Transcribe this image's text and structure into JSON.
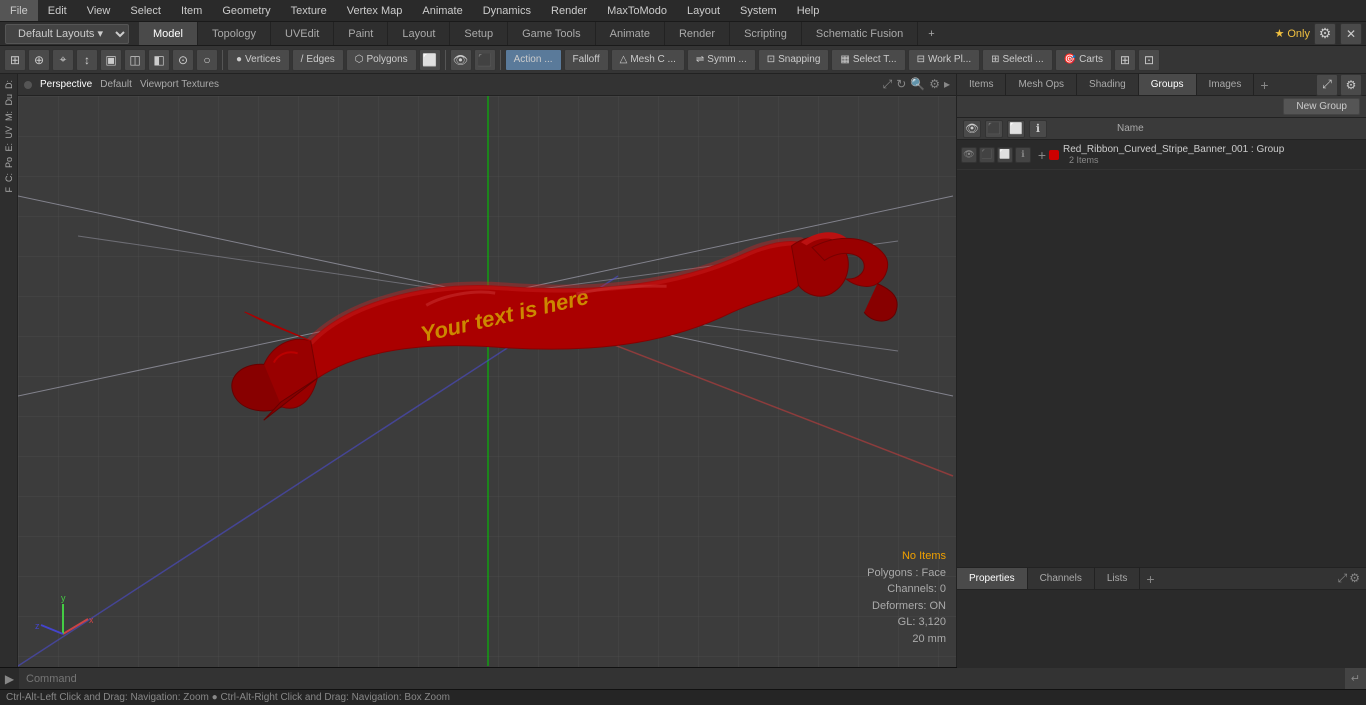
{
  "menubar": {
    "items": [
      "File",
      "Edit",
      "View",
      "Select",
      "Item",
      "Geometry",
      "Texture",
      "Vertex Map",
      "Animate",
      "Dynamics",
      "Render",
      "MaxToModo",
      "Layout",
      "System",
      "Help"
    ]
  },
  "layouts_bar": {
    "dropdown": "Default Layouts",
    "tabs": [
      "Model",
      "Topology",
      "UVEdit",
      "Paint",
      "Layout",
      "Setup",
      "Game Tools",
      "Animate",
      "Render",
      "Scripting",
      "Schematic Fusion"
    ],
    "active_tab": "Model",
    "plus": "+",
    "star_only": "★ Only"
  },
  "toolbar": {
    "mode_buttons": [
      "Vertices",
      "Edges",
      "Polygons"
    ],
    "action_label": "Action ...",
    "falloff_label": "Falloff",
    "mesh_c_label": "Mesh C ...",
    "symm_label": "Symm ...",
    "snapping_label": "Snapping",
    "select_t_label": "Select T...",
    "work_pl_label": "Work Pl...",
    "selecti_label": "Selecti ...",
    "carts_label": "Carts"
  },
  "viewport": {
    "dot_color": "#888",
    "perspective_label": "Perspective",
    "default_label": "Default",
    "viewport_textures_label": "Viewport Textures",
    "status": {
      "no_items": "No Items",
      "polygons": "Polygons : Face",
      "channels": "Channels: 0",
      "deformers": "Deformers: ON",
      "gl": "GL: 3,120",
      "size": "20 mm"
    }
  },
  "left_sidebar": {
    "letters": [
      "D",
      "Du",
      "M:",
      "UV",
      "E:",
      "Po",
      "C:",
      "F"
    ]
  },
  "right_panel": {
    "top_tabs": [
      "Items",
      "Mesh Ops",
      "Shading",
      "Groups",
      "Images"
    ],
    "active_top_tab": "Groups",
    "new_group_label": "New Group",
    "col_headers": [
      "Name"
    ],
    "groups": [
      {
        "name": "Red_Ribbon_Curved_Stripe_Banner_001 : Group",
        "count": "2 Items",
        "color": "#bb0000"
      }
    ],
    "properties_tabs": [
      "Properties",
      "Channels",
      "Lists"
    ],
    "active_prop_tab": "Properties"
  },
  "command_bar": {
    "arrow": "▶",
    "placeholder": "Command",
    "enter_icon": "↵"
  },
  "status_bar": {
    "text": "Ctrl-Alt-Left Click and Drag: Navigation: Zoom  ●  Ctrl-Alt-Right Click and Drag: Navigation: Box Zoom"
  }
}
